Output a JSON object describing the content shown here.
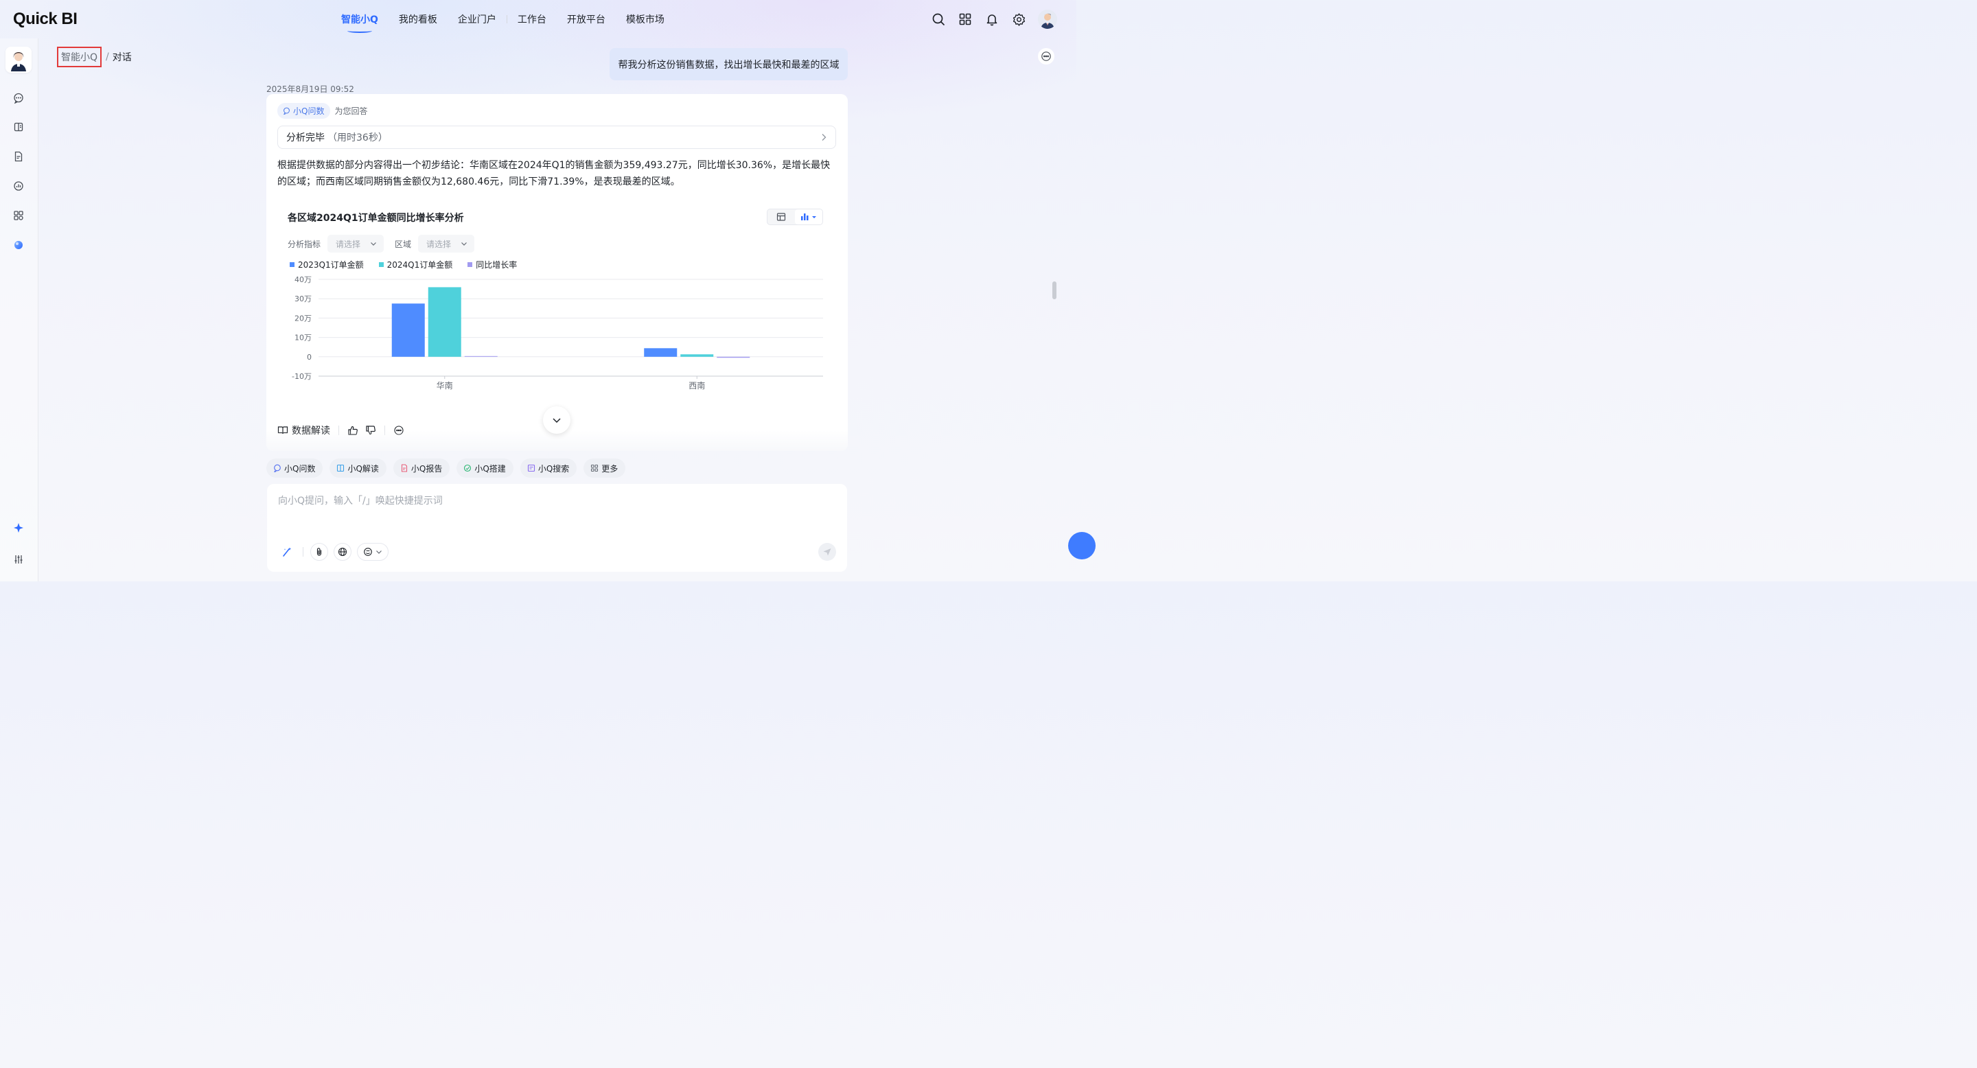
{
  "app": {
    "logo": "Quick BI"
  },
  "nav": {
    "items": [
      {
        "label": "智能小Q",
        "active": true
      },
      {
        "label": "我的看板"
      },
      {
        "label": "企业门户"
      },
      {
        "label": "工作台"
      },
      {
        "label": "开放平台"
      },
      {
        "label": "模板市场"
      }
    ]
  },
  "header_icons": [
    "search-icon",
    "apps-grid-icon",
    "bell-icon",
    "gear-icon",
    "user-avatar"
  ],
  "sidebar": {
    "items": [
      "chat-icon",
      "book-icon",
      "report-icon",
      "analysis-icon",
      "apps-icon",
      "ball-icon"
    ],
    "bottom": [
      "sparkle-icon",
      "sliders-icon"
    ]
  },
  "breadcrumb": {
    "root": "智能小Q",
    "sep": "/",
    "current": "对话"
  },
  "conversation": {
    "user_message": "帮我分析这份销售数据，找出增长最快和最差的区域",
    "timestamp": "2025年8月19日 09:52",
    "agent_tag": "小Q问数",
    "agent_text": "为您回答",
    "status_main": "分析完毕",
    "status_sub": "（用时36秒）",
    "answer": "根据提供数据的部分内容得出一个初步结论：华南区域在2024年Q1的销售金额为359,493.27元，同比增长30.36%，是增长最快的区域；而西南区域同期销售金额仅为12,680.46元，同比下滑71.39%，是表现最差的区域。"
  },
  "chart_controls": {
    "filter1_label": "分析指标",
    "filter1_placeholder": "请选择",
    "filter2_label": "区域",
    "filter2_placeholder": "请选择"
  },
  "chart_data": {
    "type": "bar",
    "title": "各区域2024Q1订单金额同比增长率分析",
    "categories": [
      "华南",
      "西南"
    ],
    "series": [
      {
        "name": "2023Q1订单金额",
        "color": "#4f8cff",
        "values": [
          275000,
          44300
        ]
      },
      {
        "name": "2024Q1订单金额",
        "color": "#4fd1db",
        "values": [
          359493.27,
          12680.46
        ]
      },
      {
        "name": "同比增长率",
        "color": "#a29bf0",
        "values": [
          0.3036,
          -0.7139
        ]
      }
    ],
    "yticks": [
      "40万",
      "30万",
      "20万",
      "10万",
      "0",
      "-10万"
    ],
    "ylim": [
      -100000,
      400000
    ],
    "grid": true,
    "legend": "top-left"
  },
  "actions": {
    "interpret": "数据解读"
  },
  "tools": [
    {
      "label": "小Q问数",
      "icon": "chat-query-icon",
      "color": "#4f6cf0"
    },
    {
      "label": "小Q解读",
      "icon": "book-icon",
      "color": "#3aa0e8"
    },
    {
      "label": "小Q报告",
      "icon": "report-icon",
      "color": "#e8607a"
    },
    {
      "label": "小Q搭建",
      "icon": "build-icon",
      "color": "#2bb673"
    },
    {
      "label": "小Q搜索",
      "icon": "search-doc-icon",
      "color": "#8a6cf0"
    },
    {
      "label": "更多",
      "icon": "more-grid-icon",
      "color": "#646a73"
    }
  ],
  "input": {
    "placeholder": "向小Q提问，输入「/」唤起快捷提示词"
  }
}
